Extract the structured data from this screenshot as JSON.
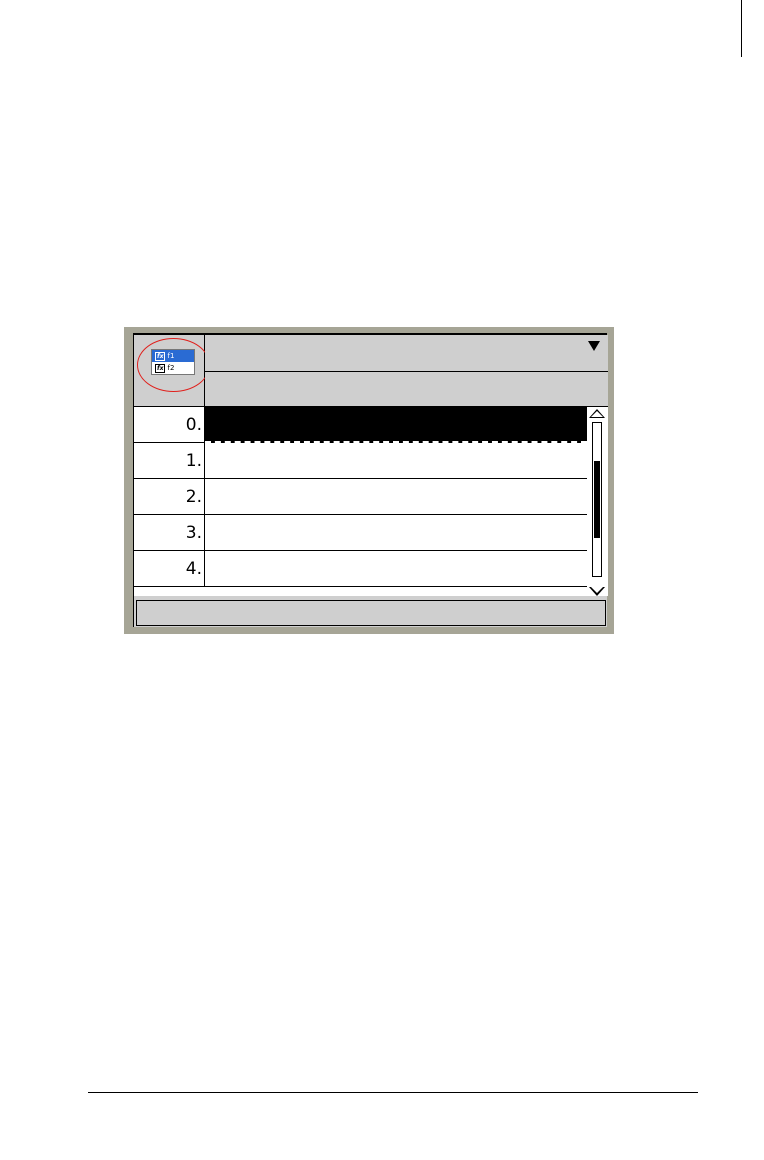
{
  "app": {
    "function_list": {
      "items": [
        {
          "icon": "function-icon",
          "icon_text": "fx",
          "label": "f1",
          "selected": true
        },
        {
          "icon": "function-icon",
          "icon_text": "fx",
          "label": "f2",
          "selected": false
        }
      ]
    },
    "header": {
      "column_title": "",
      "formula": ""
    },
    "table": {
      "rows": [
        {
          "index": "0.",
          "value": "",
          "active": true
        },
        {
          "index": "1.",
          "value": "",
          "active": false
        },
        {
          "index": "2.",
          "value": "",
          "active": false
        },
        {
          "index": "3.",
          "value": "",
          "active": false
        },
        {
          "index": "4.",
          "value": "",
          "active": false
        }
      ]
    },
    "scroll_position": 0.25,
    "scroll_visible_fraction": 0.5,
    "entry_line": ""
  },
  "colors": {
    "screen_frame": "#a6a596",
    "panel_gray": "#cfcfcf",
    "selection_blue": "#2a6bd3",
    "highlight_circle": "#e0201c"
  }
}
